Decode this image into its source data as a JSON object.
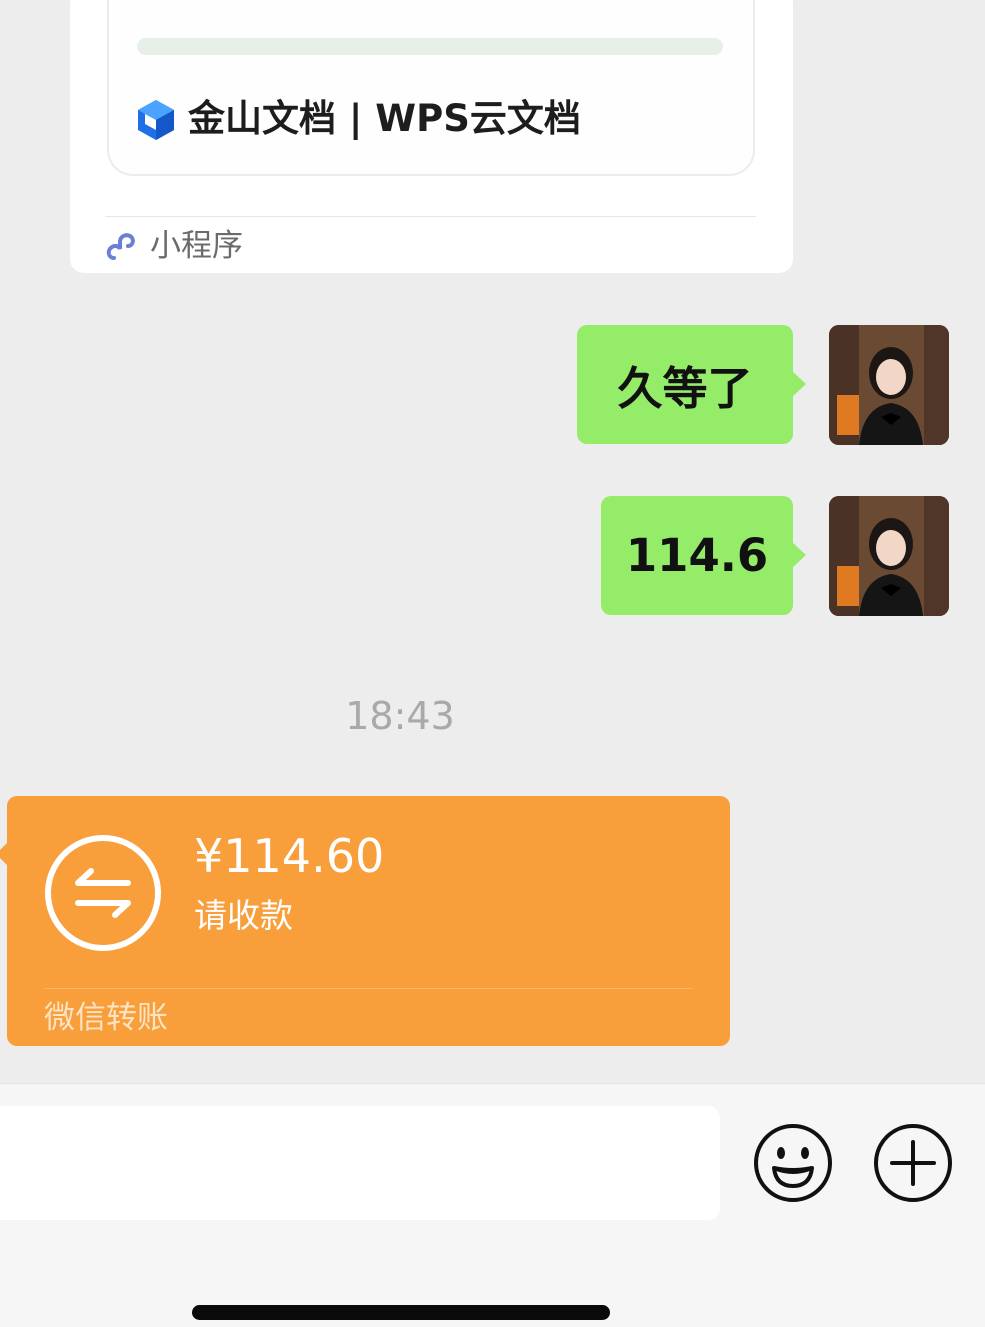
{
  "mini_program_card": {
    "brand_name": "金山文档 | WPS云文档",
    "source_label": "小程序",
    "icons": [
      "wps-cube-logo",
      "mini-program-link-icon"
    ]
  },
  "messages": [
    {
      "direction": "sent",
      "text": "久等了"
    },
    {
      "direction": "sent",
      "text": "114.6"
    }
  ],
  "timestamp": "18:43",
  "transfer": {
    "amount": "¥114.60",
    "status": "请收款",
    "source": "微信转账",
    "icon": "transfer-arrows-icon",
    "color": "#f89e3b"
  },
  "composer": {
    "input_value": "",
    "icons": [
      "emoji-icon",
      "plus-icon"
    ]
  },
  "colors": {
    "background": "#ededed",
    "sent_bubble": "#95ec69",
    "transfer_card": "#f89e3b"
  }
}
